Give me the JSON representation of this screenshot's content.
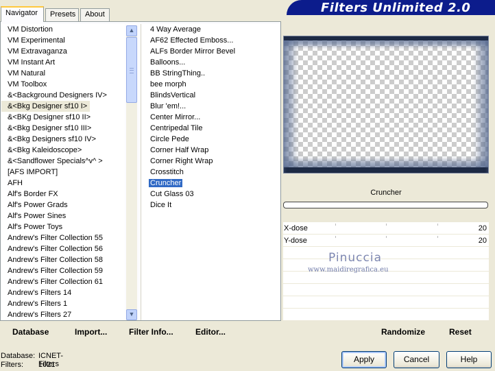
{
  "app": {
    "title": "Filters Unlimited 2.0"
  },
  "tabs": [
    {
      "label": "Navigator",
      "active": true
    },
    {
      "label": "Presets",
      "active": false
    },
    {
      "label": "About",
      "active": false
    }
  ],
  "categories": [
    "VM Distortion",
    "VM Experimental",
    "VM Extravaganza",
    "VM Instant Art",
    "VM Natural",
    "VM Toolbox",
    "&<Background Designers IV>",
    "&<Bkg Designer sf10 I>",
    "&<BKg Designer sf10 II>",
    "&<Bkg Designer sf10 III>",
    "&<Bkg Designers sf10 IV>",
    "&<Bkg Kaleidoscope>",
    "&<Sandflower Specials^v^ >",
    "[AFS IMPORT]",
    "AFH",
    "Alf's Border FX",
    "Alf's Power Grads",
    "Alf's Power Sines",
    "Alf's Power Toys",
    "Andrew's Filter Collection 55",
    "Andrew's Filter Collection 56",
    "Andrew's Filter Collection 58",
    "Andrew's Filter Collection 59",
    "Andrew's Filter Collection 61",
    "Andrew's Filters 14",
    "Andrew's Filters 1",
    "Andrew's Filters 27"
  ],
  "selected_category_index": 7,
  "filters": [
    "4 Way Average",
    "AF62 Effected Emboss...",
    "ALFs Border Mirror Bevel",
    "Balloons...",
    "BB StringThing..",
    "bee morph",
    "BlindsVertical",
    "Blur 'em!...",
    "Center Mirror...",
    "Centripedal Tile",
    "Circle Pede",
    "Corner Half Wrap",
    "Corner Right Wrap",
    "Crosstitch",
    "Cruncher",
    "Cut Glass 03",
    "Dice It"
  ],
  "selected_filter_index": 14,
  "preview": {
    "filter_name": "Cruncher"
  },
  "params": [
    {
      "label": "X-dose",
      "value": "20"
    },
    {
      "label": "Y-dose",
      "value": "20"
    }
  ],
  "watermark": {
    "name": "Pinuccia",
    "url": "www.maidiregrafica.eu"
  },
  "toolbar": {
    "database": "Database",
    "import": "Import...",
    "filter_info": "Filter Info...",
    "editor": "Editor...",
    "randomize": "Randomize",
    "reset": "Reset"
  },
  "status": {
    "database_label": "Database:",
    "database_value": "ICNET-Filters",
    "filters_label": "Filters:",
    "filters_value": "1021"
  },
  "buttons": {
    "apply": "Apply",
    "cancel": "Cancel",
    "help": "Help"
  },
  "colors": {
    "banner": "#0c1c8c",
    "selection": "#316ac5",
    "face": "#ece9d8"
  }
}
